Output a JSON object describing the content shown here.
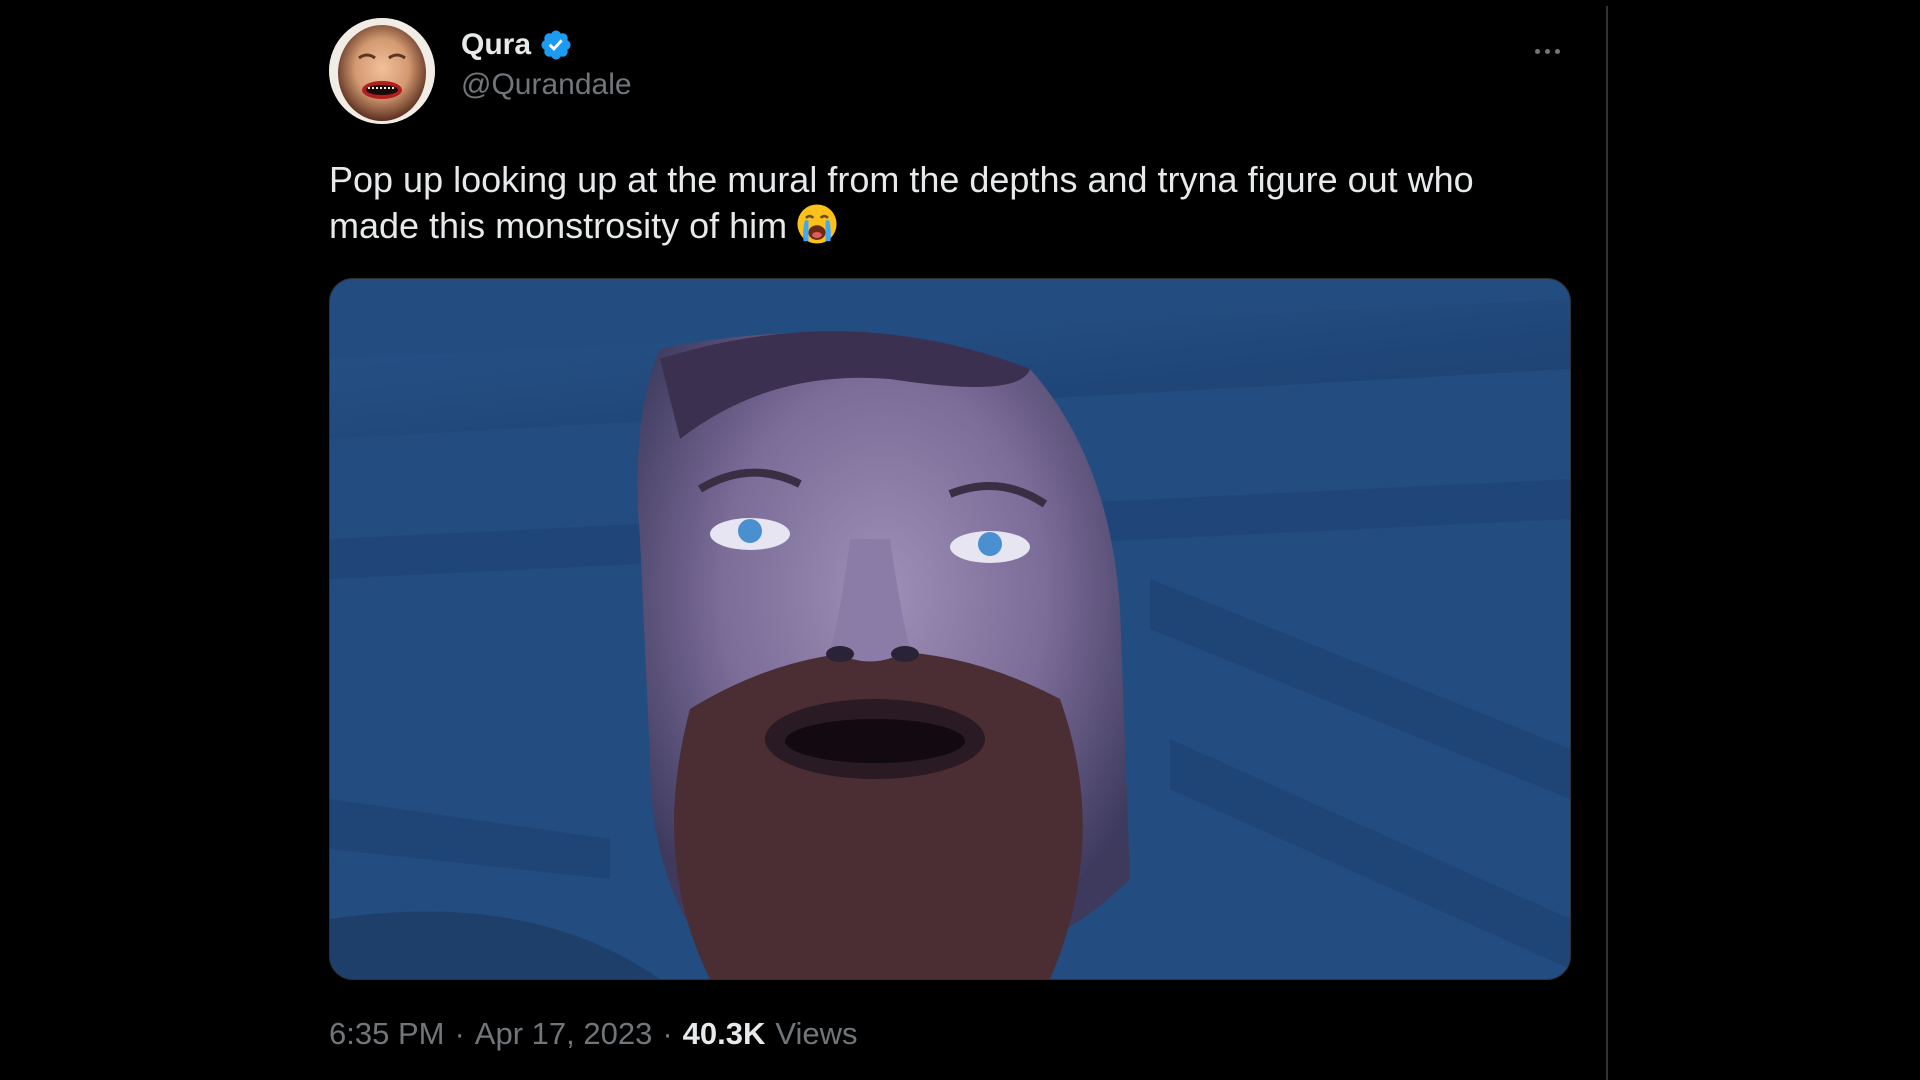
{
  "author": {
    "display_name": "Qura",
    "handle": "@Qurandale",
    "verified": true,
    "verified_color": "#1d9bf0",
    "avatar_icon": "avatar-photo"
  },
  "tweet": {
    "text": "Pop up looking up at the mural from the depths and tryna figure out who made this monstrosity of him",
    "emoji": "loudly-crying-face-emoji",
    "media_icon": "photo-man-looking-up"
  },
  "meta": {
    "time": "6:35 PM",
    "separator": "·",
    "date": "Apr 17, 2023",
    "views_count": "40.3K",
    "views_label": "Views"
  },
  "colors": {
    "background": "#000000",
    "text_primary": "#e7e9ea",
    "text_secondary": "#71767b",
    "border": "#2f3336"
  }
}
